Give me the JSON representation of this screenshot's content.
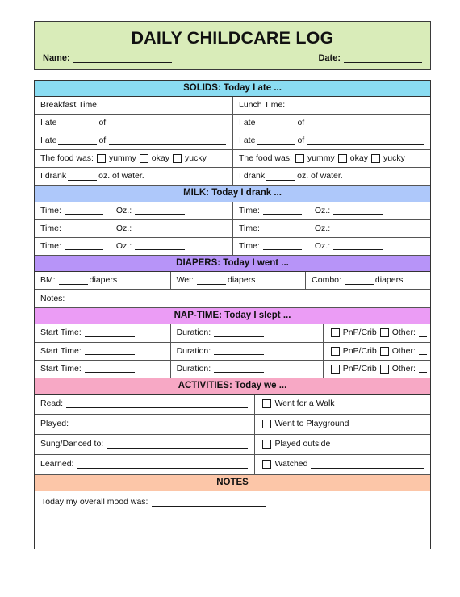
{
  "header": {
    "title": "DAILY CHILDCARE LOG",
    "name_label": "Name:",
    "date_label": "Date:",
    "bg_color": "#d9ecb9"
  },
  "sections": {
    "solids": {
      "heading": "SOLIDS: Today I ate ...",
      "bg_color": "#8adcf2",
      "breakfast_label": "Breakfast Time:",
      "lunch_label": "Lunch Time:",
      "i_ate_label": "I ate",
      "of_label": "of",
      "food_was_label": "The food was:",
      "opt_yummy": "yummy",
      "opt_okay": "okay",
      "opt_yucky": "yucky",
      "drank_prefix": "I drank",
      "drank_suffix": "oz. of water."
    },
    "milk": {
      "heading": "MILK: Today I drank ...",
      "bg_color": "#aec8fa",
      "time_label": "Time:",
      "oz_label": "Oz.:"
    },
    "diapers": {
      "heading": "DIAPERS: Today I went ...",
      "bg_color": "#b794f8",
      "bm_label": "BM:",
      "wet_label": "Wet:",
      "combo_label": "Combo:",
      "diapers_word": "diapers",
      "notes_label": "Notes:"
    },
    "naptime": {
      "heading": "NAP-TIME: Today I slept ...",
      "bg_color": "#eb9cf5",
      "start_label": "Start Time:",
      "duration_label": "Duration:",
      "pnp_label": "PnP/Crib",
      "other_label": "Other:"
    },
    "activities": {
      "heading": "ACTIVITIES: Today we ...",
      "bg_color": "#f7a8c5",
      "read_label": "Read:",
      "played_label": "Played:",
      "sung_label": "Sung/Danced to:",
      "learned_label": "Learned:",
      "chk_walk": "Went for a Walk",
      "chk_playground": "Went to Playground",
      "chk_outside": "Played outside",
      "chk_watched": "Watched"
    },
    "notes": {
      "heading": "NOTES",
      "bg_color": "#fcc6a8",
      "mood_label": "Today my overall mood was:"
    }
  }
}
